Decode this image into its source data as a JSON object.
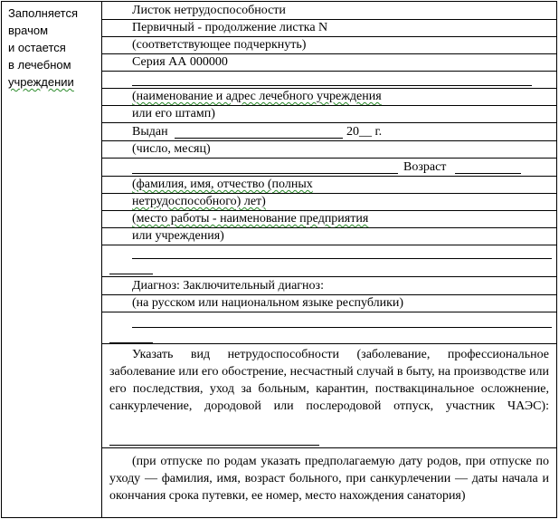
{
  "left_column": {
    "lines": [
      "Заполняется",
      "врачом",
      "и остается",
      "в лечебном",
      "учреждении"
    ]
  },
  "form": {
    "title": "Листок нетрудоспособности",
    "primary": "Первичный - продолжение листка N",
    "underline_note": "(соответствующее подчеркнуть)",
    "series": "Серия АА 000000",
    "institution_hint_1": "(наименование и адрес лечебного учреждения",
    "institution_hint_2": "или его штамп)",
    "issued_label": "Выдан",
    "year_label": "20__ г.",
    "date_hint": "(число, месяц)",
    "age_label": "Возраст",
    "name_hint_1": "(фамилия, имя, отчество (полных",
    "name_hint_2": "нетрудоспособного) лет)",
    "work_hint_1": "(место работы - наименование предприятия",
    "work_hint_2": "или учреждения)",
    "diagnosis_label": "Диагноз: Заключительный диагноз:",
    "diagnosis_hint": "(на русском или национальном языке республики)",
    "incapacity_text": "Указать вид нетрудоспособности (заболевание, профессиональное заболевание или его обострение, несчастный случай в быту, на производстве или его последствия, уход за больным, карантин, поствакцинальное осложнение, санкурлечение, дородовой или послеродовой отпуск, участник ЧАЭС):",
    "leave_text": "(при отпуске по родам указать предполагаемую дату родов, при отпуске по уходу — фамилия, имя, возраст больного, при санкурлечении — даты начала и окончания срока путевки, ее номер, место нахождения санатория)"
  }
}
